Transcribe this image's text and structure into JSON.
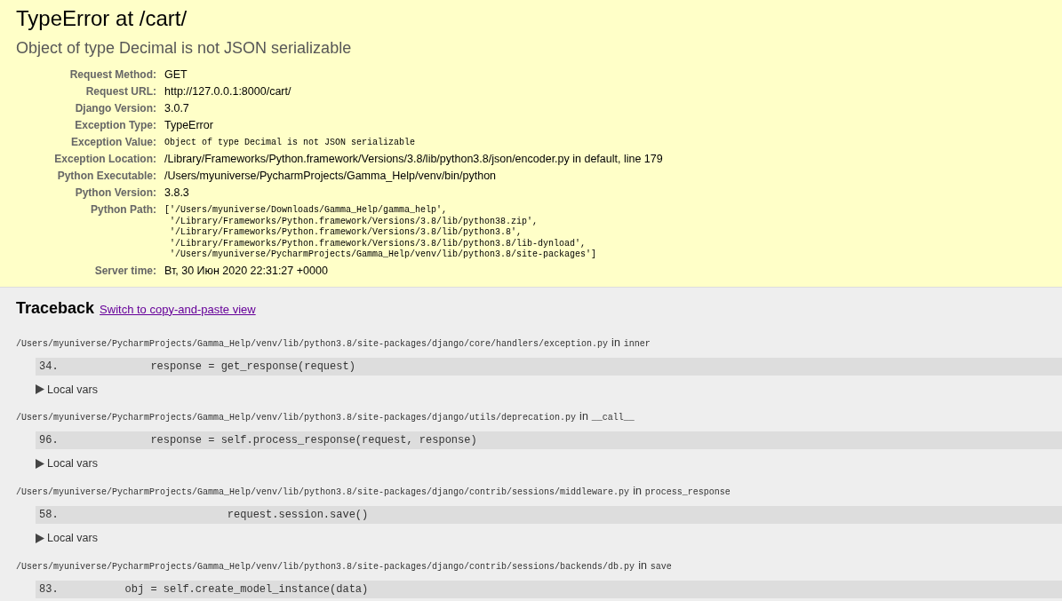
{
  "summary": {
    "title": "TypeError at /cart/",
    "subtitle": "Object of type Decimal is not JSON serializable",
    "meta": [
      {
        "label": "Request Method:",
        "value": "GET",
        "kind": "text"
      },
      {
        "label": "Request URL:",
        "value": "http://127.0.0.1:8000/cart/",
        "kind": "text"
      },
      {
        "label": "Django Version:",
        "value": "3.0.7",
        "kind": "text"
      },
      {
        "label": "Exception Type:",
        "value": "TypeError",
        "kind": "text"
      },
      {
        "label": "Exception Value:",
        "value": "Object of type Decimal is not JSON serializable",
        "kind": "code"
      },
      {
        "label": "Exception Location:",
        "value": "/Library/Frameworks/Python.framework/Versions/3.8/lib/python3.8/json/encoder.py in default, line 179",
        "kind": "text"
      },
      {
        "label": "Python Executable:",
        "value": "/Users/myuniverse/PycharmProjects/Gamma_Help/venv/bin/python",
        "kind": "text"
      },
      {
        "label": "Python Version:",
        "value": "3.8.3",
        "kind": "text"
      },
      {
        "label": "Python Path:",
        "value": "['/Users/myuniverse/Downloads/Gamma_Help/gamma_help',\n '/Library/Frameworks/Python.framework/Versions/3.8/lib/python38.zip',\n '/Library/Frameworks/Python.framework/Versions/3.8/lib/python3.8',\n '/Library/Frameworks/Python.framework/Versions/3.8/lib/python3.8/lib-dynload',\n '/Users/myuniverse/PycharmProjects/Gamma_Help/venv/lib/python3.8/site-packages']",
        "kind": "code"
      },
      {
        "label": "Server time:",
        "value": "Вт, 30 Июн 2020 22:31:27 +0000",
        "kind": "text"
      }
    ]
  },
  "traceback": {
    "title": "Traceback",
    "link": "Switch to copy-and-paste view",
    "frames": [
      {
        "file": "/Users/myuniverse/PycharmProjects/Gamma_Help/venv/lib/python3.8/site-packages/django/core/handlers/exception.py",
        "in": "in",
        "function": "inner",
        "line_number": "34.",
        "code": "            response = get_response(request)",
        "local_vars": "Local vars"
      },
      {
        "file": "/Users/myuniverse/PycharmProjects/Gamma_Help/venv/lib/python3.8/site-packages/django/utils/deprecation.py",
        "in": "in",
        "function": "__call__",
        "line_number": "96.",
        "code": "            response = self.process_response(request, response)",
        "local_vars": "Local vars"
      },
      {
        "file": "/Users/myuniverse/PycharmProjects/Gamma_Help/venv/lib/python3.8/site-packages/django/contrib/sessions/middleware.py",
        "in": "in",
        "function": "process_response",
        "line_number": "58.",
        "code": "                        request.session.save()",
        "local_vars": "Local vars"
      },
      {
        "file": "/Users/myuniverse/PycharmProjects/Gamma_Help/venv/lib/python3.8/site-packages/django/contrib/sessions/backends/db.py",
        "in": "in",
        "function": "save",
        "line_number": "83.",
        "code": "        obj = self.create_model_instance(data)"
      }
    ]
  }
}
